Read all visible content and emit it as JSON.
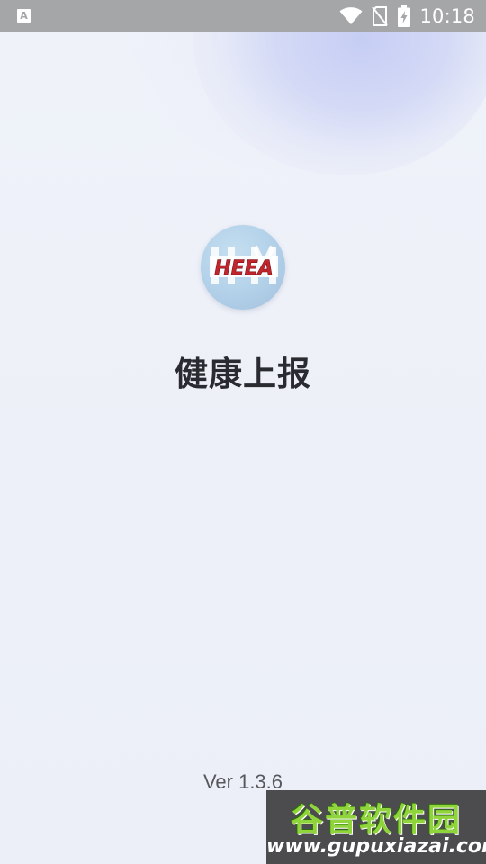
{
  "status_bar": {
    "left_icon_letter": "A",
    "time": "10:18",
    "icons": [
      "wifi-icon",
      "no-sim-icon",
      "battery-charging-icon"
    ]
  },
  "logo": {
    "text": "HEEA",
    "colors": {
      "letters": "#c0262c",
      "background": "#b5d3ea"
    }
  },
  "app_name": "健康上报",
  "version": "Ver 1.3.6",
  "watermark": {
    "title": "谷普软件园",
    "url": "www.gupuxiazai.com"
  },
  "colors": {
    "background": "#eef1f8",
    "accent_glow": "#c4ccf4",
    "status_bar": "#a5a6a8",
    "title": "#2a2b30",
    "version": "#56585c",
    "watermark_green": "#8fd43a"
  }
}
